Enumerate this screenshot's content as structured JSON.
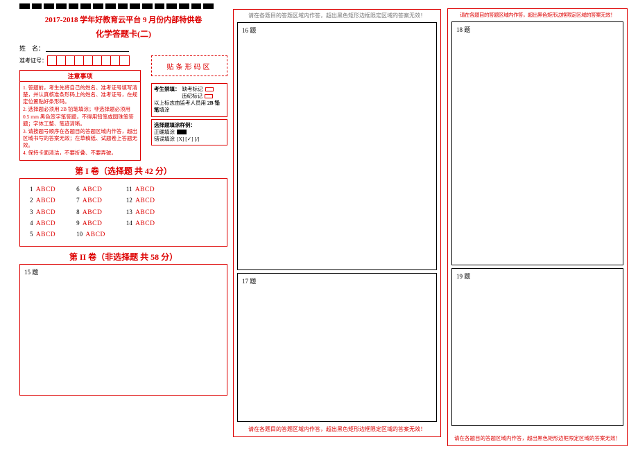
{
  "header": {
    "title_line1": "2017-2018 学年好教育云平台 9 月份内部特供卷",
    "title_line2": "化学答题卡(二)"
  },
  "student": {
    "name_label": "姓　名：",
    "ticket_label": "准考证号："
  },
  "barcode_label": "贴条形码区",
  "notice": {
    "heading": "注意事项",
    "items": [
      "1. 答题前，考生先将自己的姓名、准考证号填写清楚，并认真核准条形码上的姓名、准考证号，在规定位置贴好条形码。",
      "2. 选择题必须用 2B 铅笔填涂；非选择题必须用 0.5 mm 黑色签字笔答题，不得用铅笔或圆珠笔答题；字体工整、笔迹清晰。",
      "3. 请按题号顺序在各题目的答题区域内作答，超出区域书写的答案无效；在草稿纸、试题卷上答题无效。",
      "4. 保持卡面清洁，不要折叠、不要弄破。"
    ]
  },
  "rules": {
    "box1": {
      "l1a": "考生禁填：",
      "l1b": "缺考标记",
      "l2": "违纪标记",
      "l3": "以上标志由监考人员用 2B 铅笔填涂"
    },
    "box2": {
      "head": "选择题填涂样例：",
      "ok": "正确填涂",
      "bad": "错误填涂",
      "bad_eg": "[X] [✓] [/]"
    }
  },
  "sections": {
    "s1": "第 I 卷（选择题 共 42 分）",
    "s2": "第 II 卷（非选择题 共 58 分）"
  },
  "mcq": {
    "options": "ABCD",
    "col1": [
      "1",
      "2",
      "3",
      "4",
      "5"
    ],
    "col2": [
      "6",
      "7",
      "8",
      "9",
      "10"
    ],
    "col3": [
      "11",
      "12",
      "13",
      "14"
    ]
  },
  "free": {
    "q15": "15 题",
    "q16": "16 题",
    "q17": "17 题",
    "q18": "18 题",
    "q19": "19 题"
  },
  "warnings": {
    "mid_top": "请在各题目的答题区域内作答，超出黑色矩形边框限定区域的答案无效！",
    "mid_bot": "请在各题目的答题区域内作答，超出黑色矩形边框限定区域的答案无效！",
    "r_top": "请在各题目的答题区域内作答，超出黑色矩形边框限定区域的答案无效！",
    "r_bot": "请在各题目的答题区域内作答，超出黑色矩形边框限定区域的答案无效！"
  }
}
